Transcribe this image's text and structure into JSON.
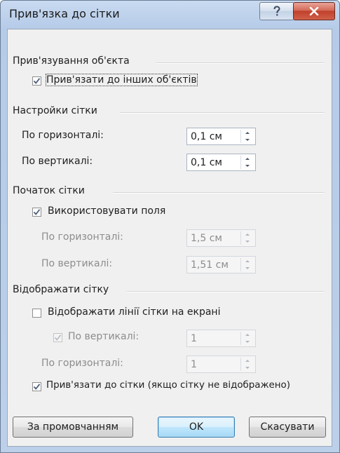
{
  "window": {
    "title": "Прив'язка до сітки",
    "help_icon": "question-mark-icon",
    "close_icon": "close-x-icon"
  },
  "snap_objects": {
    "group_title": "Прив'язування об'єкта",
    "snap_to_other_objects": {
      "label": "Прив'язати до інших об'єктів",
      "checked": true
    }
  },
  "grid_settings": {
    "group_title": "Настройки сітки",
    "horizontal": {
      "label": "По горизонталі:",
      "value": "0,1 см"
    },
    "vertical": {
      "label": "По вертикалі:",
      "value": "0,1 см"
    }
  },
  "grid_origin": {
    "group_title": "Початок сітки",
    "use_margins": {
      "label": "Використовувати поля",
      "checked": true
    },
    "horizontal": {
      "label": "По горизонталі:",
      "value": "1,5 см",
      "enabled": false
    },
    "vertical": {
      "label": "По вертикалі:",
      "value": "1,51 см",
      "enabled": false
    }
  },
  "show_grid": {
    "group_title": "Відображати сітку",
    "display_gridlines": {
      "label": "Відображати лінії сітки на екрані",
      "checked": false
    },
    "vertical_every": {
      "label": "По вертикалі:",
      "value": "1",
      "checked": true,
      "enabled": false
    },
    "horizontal_every": {
      "label": "По горизонталі:",
      "value": "1",
      "enabled": false
    },
    "snap_when_hidden": {
      "label": "Прив'язати до сітки (якщо сітку не відображено)",
      "checked": true
    }
  },
  "buttons": {
    "set_default": "За промовчанням",
    "ok": "OK",
    "cancel": "Скасувати"
  }
}
